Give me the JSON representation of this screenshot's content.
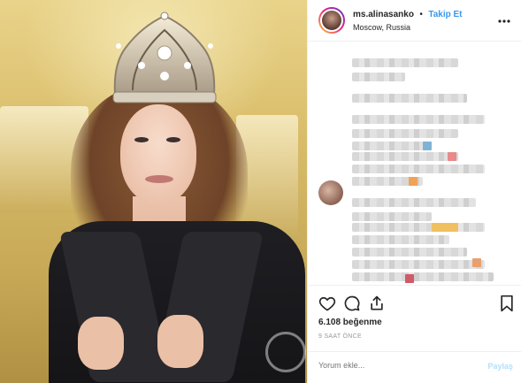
{
  "header": {
    "username": "ms.alinasanko",
    "separator": "•",
    "follow_label": "Takip Et",
    "location": "Moscow, Russia",
    "more_icon": "more-horizontal-icon"
  },
  "actions": {
    "like_icon": "heart-icon",
    "comment_icon": "comment-icon",
    "share_icon": "share-icon",
    "save_icon": "bookmark-icon"
  },
  "likes_text": "6.108 beğenme",
  "time_text": "9 SAAT ÖNCE",
  "comment_box": {
    "placeholder": "Yorum ekle...",
    "post_label": "Paylaş"
  },
  "colors": {
    "link": "#3897f0",
    "post_disabled": "#b2dffc",
    "muted": "#999999",
    "text": "#262626"
  }
}
